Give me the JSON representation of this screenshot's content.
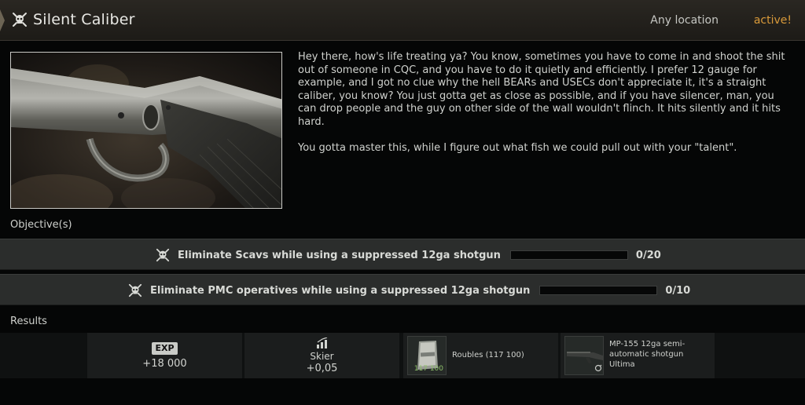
{
  "header": {
    "title": "Silent Caliber",
    "location": "Any location",
    "status": "active!"
  },
  "description": {
    "paragraph1": "Hey there, how's life treating ya? You know, sometimes you have to come in and shoot the shit out of someone in CQC, and you have to do it quietly and efficiently. I prefer 12 gauge for example, and I got no clue why the hell BEARs and USECs don't appreciate it, it's a straight caliber, you know? You just gotta get as close as possible, and if you have silencer, man, you can drop people and the guy on other side of the wall wouldn't flinch. It hits silently and it hits hard.",
    "paragraph2": "You gotta master this, while I figure out what fish we could pull out with your \"talent\"."
  },
  "objectives_label": "Objective(s)",
  "objectives": [
    {
      "text": "Eliminate Scavs while using a suppressed 12ga shotgun",
      "progress": "0/20",
      "fraction": 0,
      "icon": "skull-icon"
    },
    {
      "text": "Eliminate PMC operatives while using a suppressed 12ga shotgun",
      "progress": "0/10",
      "fraction": 0,
      "icon": "skull-icon"
    }
  ],
  "results_label": "Results",
  "rewards": {
    "exp": {
      "badge": "EXP",
      "value": "+18 000"
    },
    "skill": {
      "name": "Skier",
      "value": "+0,05",
      "icon": "trend-up-icon"
    },
    "roubles": {
      "label": "Roubles (117 100)",
      "count": "117 100",
      "icon": "roubles-stack-icon"
    },
    "weapon": {
      "label": "MP-155 12ga semi-automatic shotgun Ultima",
      "icon": "shotgun-icon"
    }
  },
  "colors": {
    "accent_status": "#d99a3a",
    "header_bg": "#2a2722",
    "objective_bg": "#2b2d2c",
    "roubles_count": "#8ec06a"
  }
}
